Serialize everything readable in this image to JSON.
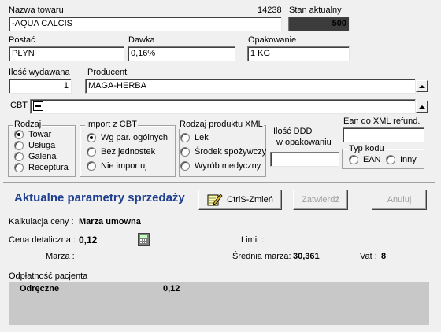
{
  "product": {
    "name_label": "Nazwa towaru",
    "code": "14238",
    "name_value": "-AQUA CALCIS",
    "stock_label": "Stan aktualny",
    "stock_value": "500",
    "form_label": "Postać",
    "form_value": "PŁYN",
    "dose_label": "Dawka",
    "dose_value": "0,16%",
    "package_label": "Opakowanie",
    "package_value": "1 KG",
    "qty_label": "Ilość wydawana",
    "qty_value": "1",
    "producer_label": "Producent",
    "producer_value": "MAGA-HERBA",
    "cbt_label": "CBT"
  },
  "rodzaj": {
    "title": "Rodzaj",
    "options": [
      "Towar",
      "Usługa",
      "Galena",
      "Receptura"
    ],
    "selected": 0
  },
  "import_cbt": {
    "title": "Import z CBT",
    "options": [
      "Wg par. ogólnych",
      "Bez jednostek",
      "Nie importuj"
    ],
    "selected": 0
  },
  "xml_type": {
    "title": "Rodzaj produktu XML",
    "options": [
      "Lek",
      "Środek spożywczy",
      "Wyrób medyczny"
    ],
    "selected": -1
  },
  "ddd": {
    "label_line1": "Ilość DDD",
    "label_line2": "w opakowaniu",
    "value": ""
  },
  "ean_xml": {
    "label": "Ean do XML refund.",
    "value": ""
  },
  "code_type": {
    "title": "Typ kodu",
    "options": [
      "EAN",
      "Inny"
    ],
    "selected": -1
  },
  "sales": {
    "title": "Aktualne parametry sprzedaży",
    "change_button": "CtrlS-Zmień",
    "confirm_button": "Zatwierdź",
    "cancel_button": "Anuluj",
    "calc_label": "Kalkulacja ceny :",
    "calc_value": "Marza umowna",
    "retail_label": "Cena detaliczna :",
    "retail_value": "0,12",
    "limit_label": "Limit :",
    "margin_label": "Marża :",
    "avg_margin_label": "Średnia marża:",
    "avg_margin_value": "30,361",
    "vat_label": "Vat :",
    "vat_value": "8",
    "patient_label": "Odpłatność pacjenta",
    "patient_kind": "Odręczne",
    "patient_value": "0,12"
  },
  "colors": {
    "stock_bg": "#3c3c3c",
    "title_blue": "#1f3f8f",
    "bottom_panel": "#c8c8c8"
  }
}
